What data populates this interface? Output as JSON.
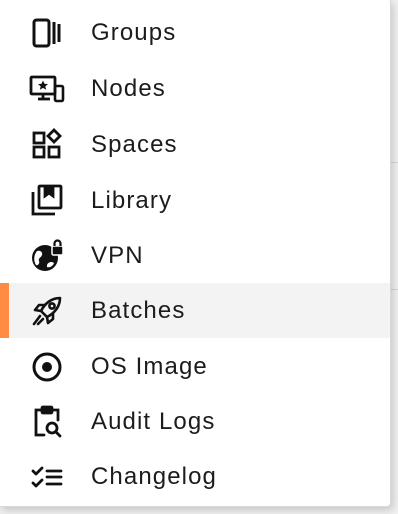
{
  "menu": {
    "items": [
      {
        "label": "Groups",
        "icon": "groups-icon",
        "active": false
      },
      {
        "label": "Nodes",
        "icon": "nodes-icon",
        "active": false
      },
      {
        "label": "Spaces",
        "icon": "spaces-icon",
        "active": false
      },
      {
        "label": "Library",
        "icon": "library-icon",
        "active": false
      },
      {
        "label": "VPN",
        "icon": "vpn-icon",
        "active": false
      },
      {
        "label": "Batches",
        "icon": "rocket-icon",
        "active": true
      },
      {
        "label": "OS Image",
        "icon": "os-image-icon",
        "active": false
      },
      {
        "label": "Audit Logs",
        "icon": "audit-logs-icon",
        "active": false
      },
      {
        "label": "Changelog",
        "icon": "changelog-icon",
        "active": false
      }
    ]
  },
  "colors": {
    "active_indicator": "#ff8c42",
    "active_background": "#f3f3f3",
    "text": "#1c1c1c"
  }
}
